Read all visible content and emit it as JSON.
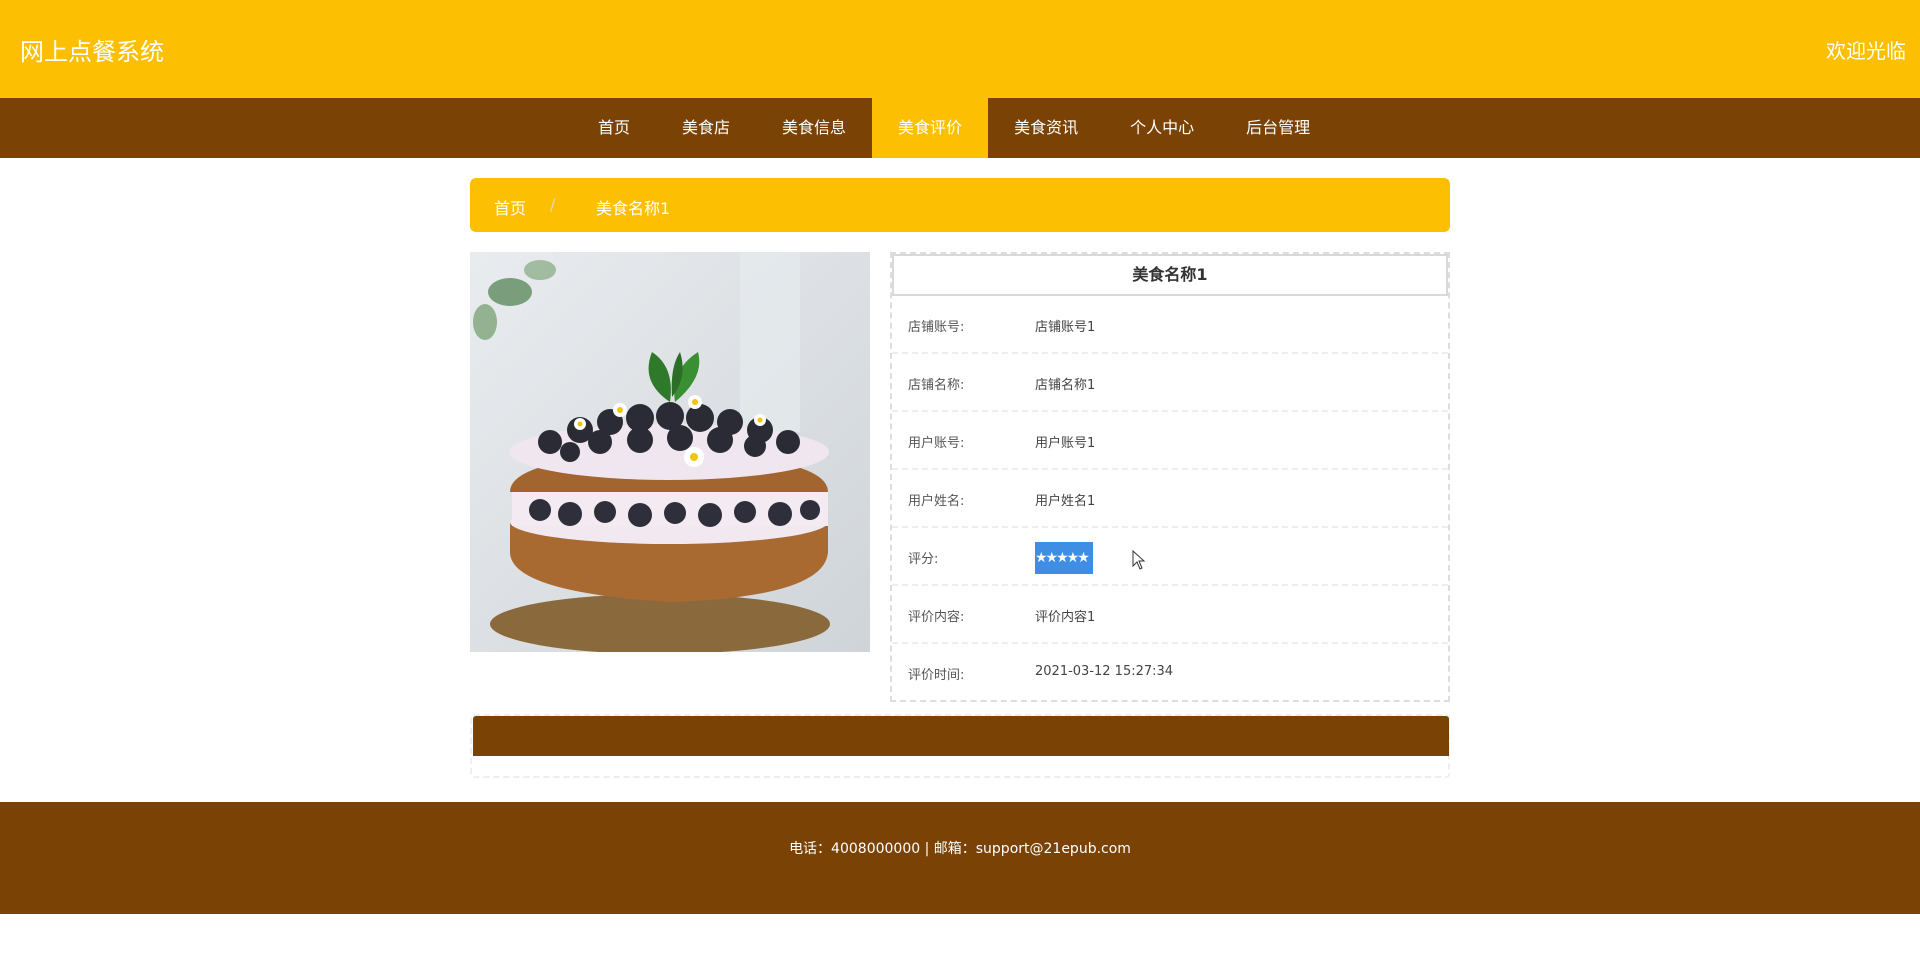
{
  "header": {
    "site_title": "网上点餐系统",
    "welcome": "欢迎光临"
  },
  "nav": {
    "items": [
      {
        "label": "首页"
      },
      {
        "label": "美食店"
      },
      {
        "label": "美食信息"
      },
      {
        "label": "美食评价",
        "active": true
      },
      {
        "label": "美食资讯"
      },
      {
        "label": "个人中心"
      },
      {
        "label": "后台管理"
      }
    ]
  },
  "breadcrumb": {
    "home": "首页",
    "separator": "/",
    "current": "美食名称1"
  },
  "detail": {
    "title": "美食名称1",
    "rows": [
      {
        "label": "店铺账号:",
        "value": "店铺账号1"
      },
      {
        "label": "店铺名称:",
        "value": "店铺名称1"
      },
      {
        "label": "用户账号:",
        "value": "用户账号1"
      },
      {
        "label": "用户姓名:",
        "value": "用户姓名1"
      },
      {
        "label": "评分:",
        "value": "★★★★★"
      },
      {
        "label": "评价内容:",
        "value": "评价内容1"
      },
      {
        "label": "评价时间:",
        "value": "2021-03-12 15:27:34"
      }
    ]
  },
  "rating": {
    "stars": 5,
    "max": 5
  },
  "footer": {
    "contact": "电话：4008000000 | 邮箱：support@21epub.com"
  },
  "colors": {
    "primary": "#fcbf02",
    "secondary": "#7a4204",
    "selection": "#3f8ee6"
  },
  "image": {
    "subject": "cake-photo"
  }
}
